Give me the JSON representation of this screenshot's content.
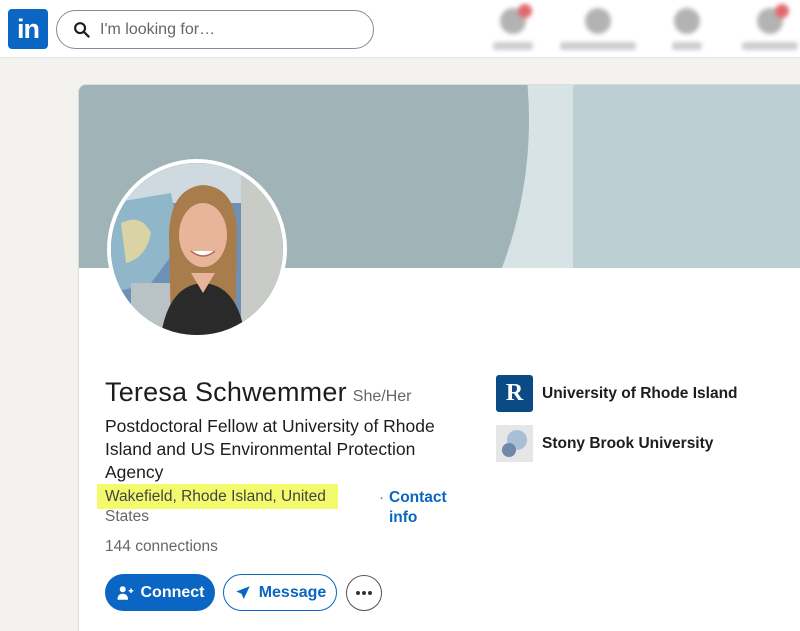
{
  "nav": {
    "logo_text": "in",
    "search_placeholder": "I'm looking for…"
  },
  "profile": {
    "name": "Teresa Schwemmer",
    "pronouns": "She/Her",
    "headline": "Postdoctoral Fellow at University of Rhode Island and US Environmental Protection Agency",
    "location_part1": "Wakefield, Rhode Island, United",
    "location_part2": "States",
    "contact_separator": "·",
    "contact_label_1": "Contact",
    "contact_label_2": "info",
    "connections_count": "144",
    "connections_label": "connections"
  },
  "actions": {
    "connect_label": "Connect",
    "message_label": "Message"
  },
  "education": [
    {
      "name": "University of Rhode Island",
      "logo_letter": "R"
    },
    {
      "name": "Stony Brook University"
    }
  ],
  "colors": {
    "brand": "#0a66c2",
    "highlight": "#f3fb6d"
  }
}
